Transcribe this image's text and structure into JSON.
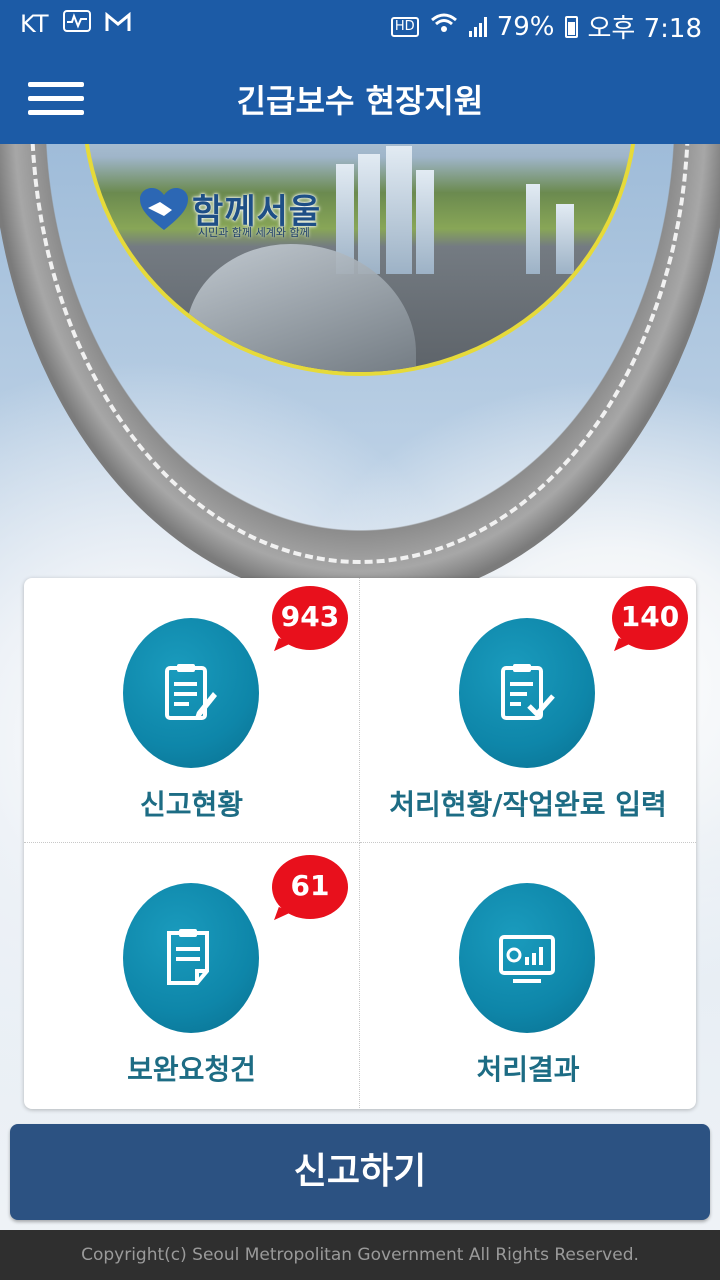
{
  "status_bar": {
    "carrier": "KT",
    "battery": "79%",
    "time": "오후 7:18",
    "hd": "HD",
    "icons": [
      "activity-icon",
      "gmail-icon",
      "hd-icon",
      "wifi-icon",
      "signal-icon",
      "battery-icon"
    ]
  },
  "app_bar": {
    "title": "긴급보수 현장지원",
    "menu_icon": "hamburger-menu-icon"
  },
  "hero": {
    "logo_text": "함께서울",
    "logo_sub": "시민과 함께 세계와 함께"
  },
  "menu": {
    "items": [
      {
        "label": "신고현황",
        "badge": "943",
        "icon": "report-list-icon"
      },
      {
        "label": "처리현황/작업완료 입력",
        "badge": "140",
        "icon": "checklist-icon"
      },
      {
        "label": "보완요청건",
        "badge": "61",
        "icon": "clipboard-icon"
      },
      {
        "label": "처리결과",
        "badge": "",
        "icon": "monitor-chart-icon"
      }
    ]
  },
  "report_button": {
    "label": "신고하기"
  },
  "footer": {
    "copyright": "Copyright(c) Seoul Metropolitan Government All Rights Reserved."
  },
  "colors": {
    "app_bar": "#1c5ba6",
    "circle": "#0e86a9",
    "label": "#1d6c84",
    "badge": "#e8101c",
    "button": "#2c5282",
    "footer": "#2f2f2f"
  }
}
